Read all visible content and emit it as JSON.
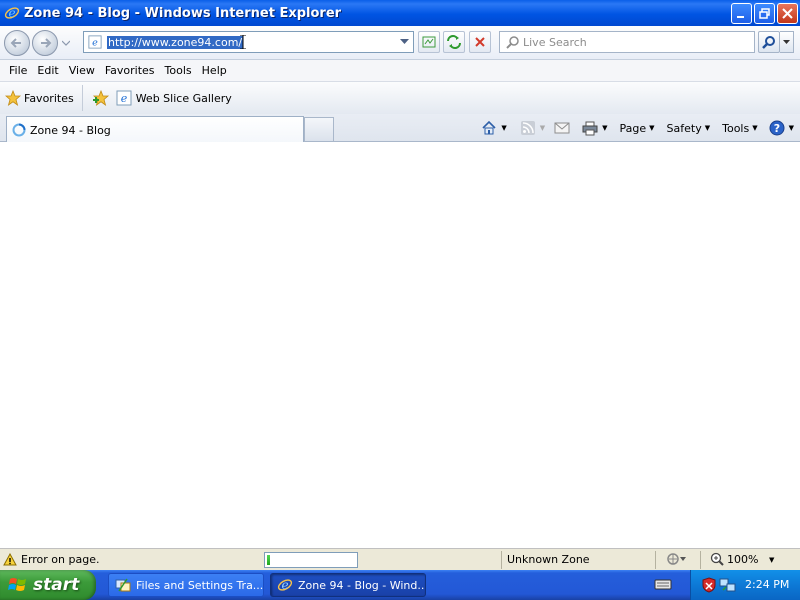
{
  "window": {
    "title": "Zone 94 - Blog - Windows Internet Explorer"
  },
  "address": {
    "url": "http://www.zone94.com/"
  },
  "search": {
    "placeholder": "Live Search"
  },
  "menu": [
    "File",
    "Edit",
    "View",
    "Favorites",
    "Tools",
    "Help"
  ],
  "favorites_bar": {
    "favorites_label": "Favorites",
    "web_slice_label": "Web Slice Gallery"
  },
  "tab": {
    "label": "Zone 94 - Blog"
  },
  "command_bar": {
    "page": "Page",
    "safety": "Safety",
    "tools": "Tools"
  },
  "status": {
    "message": "Error on page.",
    "progress_percent": 3,
    "zone": "Unknown Zone",
    "zoom": "100%"
  },
  "taskbar": {
    "start": "start",
    "tasks": [
      {
        "label": "Files and Settings Tra..."
      },
      {
        "label": "Zone 94 - Blog - Wind..."
      }
    ],
    "time": "2:24 PM"
  },
  "colors": {
    "titlebar": "#0054e3",
    "taskbar": "#245edb",
    "start": "#3c9b3a",
    "url_highlight": "#316ac5"
  }
}
